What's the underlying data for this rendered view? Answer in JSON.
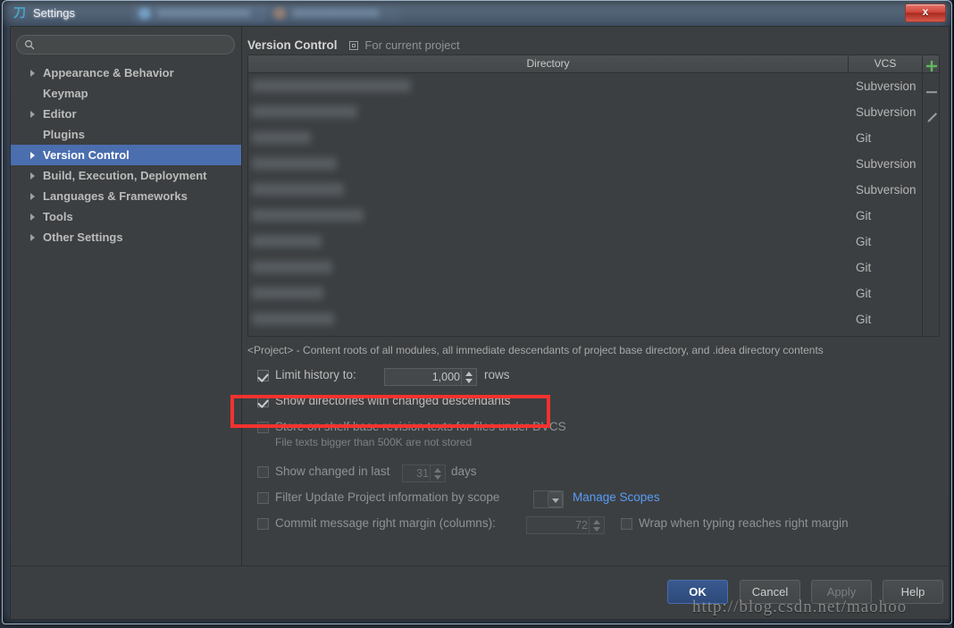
{
  "window": {
    "title": "Settings",
    "app_icon": "intellij-idea-icon",
    "close_label": "x"
  },
  "search": {
    "value": "",
    "placeholder": "",
    "icon": "search-icon"
  },
  "sidebar": {
    "items": [
      {
        "label": "Appearance & Behavior",
        "expandable": true,
        "selected": false
      },
      {
        "label": "Keymap",
        "expandable": false,
        "selected": false
      },
      {
        "label": "Editor",
        "expandable": true,
        "selected": false
      },
      {
        "label": "Plugins",
        "expandable": false,
        "selected": false
      },
      {
        "label": "Version Control",
        "expandable": true,
        "selected": true
      },
      {
        "label": "Build, Execution, Deployment",
        "expandable": true,
        "selected": false
      },
      {
        "label": "Languages & Frameworks",
        "expandable": true,
        "selected": false
      },
      {
        "label": "Tools",
        "expandable": true,
        "selected": false
      },
      {
        "label": "Other Settings",
        "expandable": true,
        "selected": false
      }
    ]
  },
  "panel": {
    "title": "Version Control",
    "scope_icon": "project-scope-icon",
    "scope_label": "For current project"
  },
  "table": {
    "columns": [
      "Directory",
      "VCS"
    ],
    "rows": [
      {
        "directory": "",
        "vcs": "Subversion",
        "blur_width": 178
      },
      {
        "directory": "",
        "vcs": "Subversion",
        "blur_width": 118
      },
      {
        "directory": "",
        "vcs": "Git",
        "blur_width": 66
      },
      {
        "directory": "",
        "vcs": "Subversion",
        "blur_width": 95
      },
      {
        "directory": "",
        "vcs": "Subversion",
        "blur_width": 103
      },
      {
        "directory": "",
        "vcs": "Git",
        "blur_width": 125
      },
      {
        "directory": "",
        "vcs": "Git",
        "blur_width": 78
      },
      {
        "directory": "",
        "vcs": "Git",
        "blur_width": 90
      },
      {
        "directory": "",
        "vcs": "Git",
        "blur_width": 80
      },
      {
        "directory": "",
        "vcs": "Git",
        "blur_width": 92
      }
    ],
    "toolbar": [
      {
        "name": "add-directory-button",
        "icon": "plus-icon",
        "color": "#5fb95f"
      },
      {
        "name": "remove-directory-button",
        "icon": "minus-icon",
        "color": "#9a9a9a"
      },
      {
        "name": "edit-directory-button",
        "icon": "pencil-icon",
        "color": "#9a9a9a"
      }
    ]
  },
  "hint": "<Project> - Content roots of all modules, all immediate descendants of project base directory, and .idea directory contents",
  "options": {
    "limit_history": {
      "label": "Limit history to:",
      "checked": true,
      "value": "1,000",
      "suffix": "rows"
    },
    "show_directories": {
      "label": "Show directories with changed descendants",
      "checked": true,
      "highlighted": true
    },
    "store_on_shelf": {
      "label": "Store on shelf base revision texts for files under DVCS",
      "checked": false,
      "note": "File texts bigger than 500K are not stored"
    },
    "show_changed_in_last": {
      "label": "Show changed in last",
      "checked": false,
      "value": "31",
      "suffix": "days"
    },
    "filter_by_scope": {
      "label": "Filter Update Project information by scope",
      "checked": false,
      "combo_value": "",
      "link_label": "Manage Scopes"
    },
    "commit_margin": {
      "label": "Commit message right margin (columns):",
      "checked": false,
      "value": "72",
      "wrap_label": "Wrap when typing reaches right margin",
      "wrap_checked": false
    }
  },
  "footer": {
    "buttons": [
      {
        "label": "OK",
        "style": "primary",
        "name": "ok-button"
      },
      {
        "label": "Cancel",
        "style": "normal",
        "name": "cancel-button"
      },
      {
        "label": "Apply",
        "style": "disabled",
        "name": "apply-button"
      },
      {
        "label": "Help",
        "style": "normal",
        "name": "help-button"
      }
    ]
  },
  "watermark": "http://blog.csdn.net/maohoo",
  "colors": {
    "dialog_bg": "#3c3f41",
    "selection": "#4b6eaf",
    "link": "#589df6",
    "highlight_box": "#f5322e",
    "add_icon": "#5fb95f"
  }
}
